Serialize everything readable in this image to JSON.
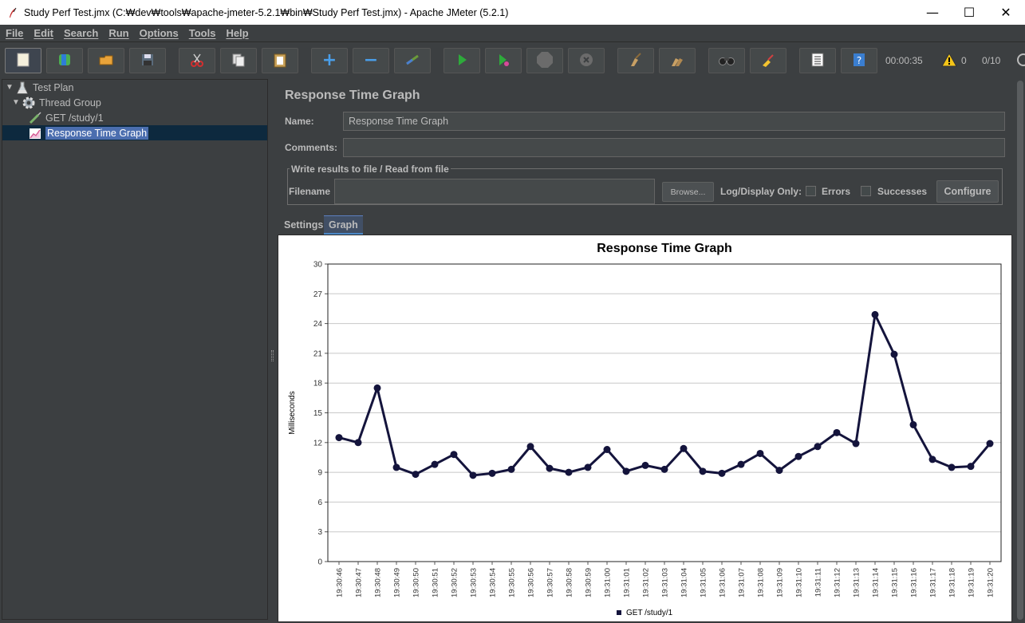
{
  "window": {
    "title": "Study Perf Test.jmx (C:₩dev₩tools₩apache-jmeter-5.2.1₩bin₩Study Perf Test.jmx) - Apache JMeter (5.2.1)",
    "minimize": "—",
    "maximize": "☐",
    "close": "✕"
  },
  "menu": {
    "items": [
      "File",
      "Edit",
      "Search",
      "Run",
      "Options",
      "Tools",
      "Help"
    ]
  },
  "toolbar": {
    "elapsed_time": "00:00:35",
    "warning_count": "0",
    "thread_count": "0/10",
    "icons": [
      "new-icon",
      "templates-icon",
      "open-icon",
      "save-icon",
      "cut-icon",
      "copy-icon",
      "paste-icon",
      "expand-icon",
      "collapse-icon",
      "toggle-icon",
      "start-icon",
      "start-no-pause-icon",
      "stop-icon",
      "shutdown-icon",
      "clear-icon",
      "clear-all-icon",
      "search-icon",
      "reset-search-icon",
      "function-helper-icon",
      "help-icon"
    ]
  },
  "tree": {
    "items": [
      {
        "label": "Test Plan",
        "icon": "test-plan-icon"
      },
      {
        "label": "Thread Group",
        "icon": "thread-group-icon"
      },
      {
        "label": "GET /study/1",
        "icon": "http-sampler-icon"
      },
      {
        "label": "Response Time Graph",
        "icon": "graph-listener-icon"
      }
    ]
  },
  "panel": {
    "title": "Response Time Graph",
    "name_label": "Name:",
    "name_value": "Response Time Graph",
    "comments_label": "Comments:",
    "comments_value": "",
    "group_title": "Write results to file / Read from file",
    "filename_label": "Filename",
    "filename_value": "",
    "browse_label": "Browse...",
    "log_display_label": "Log/Display Only:",
    "errors_label": "Errors",
    "successes_label": "Successes",
    "configure_label": "Configure",
    "tabs": [
      "Settings",
      "Graph"
    ],
    "active_tab": "Graph"
  },
  "chart_data": {
    "type": "line",
    "title": "Response Time Graph",
    "xlabel": "",
    "ylabel": "Milliseconds",
    "ylim": [
      0,
      30
    ],
    "yticks": [
      0,
      3,
      6,
      9,
      12,
      15,
      18,
      21,
      24,
      27,
      30
    ],
    "grid": true,
    "legend_position": "bottom",
    "x": [
      "19:30:46",
      "19:30:47",
      "19:30:48",
      "19:30:49",
      "19:30:50",
      "19:30:51",
      "19:30:52",
      "19:30:53",
      "19:30:54",
      "19:30:55",
      "19:30:56",
      "19:30:57",
      "19:30:58",
      "19:30:59",
      "19:31:00",
      "19:31:01",
      "19:31:02",
      "19:31:03",
      "19:31:04",
      "19:31:05",
      "19:31:06",
      "19:31:07",
      "19:31:08",
      "19:31:09",
      "19:31:10",
      "19:31:11",
      "19:31:12",
      "19:31:13",
      "19:31:14",
      "19:31:15",
      "19:31:16",
      "19:31:17",
      "19:31:18",
      "19:31:19",
      "19:31:20"
    ],
    "series": [
      {
        "name": "GET /study/1",
        "color": "#14143c",
        "values": [
          12.5,
          12,
          17.5,
          9.5,
          8.8,
          9.8,
          10.8,
          8.7,
          8.9,
          9.3,
          11.6,
          9.4,
          9,
          9.5,
          11.3,
          9.1,
          9.7,
          9.3,
          11.4,
          9.1,
          8.9,
          9.8,
          10.9,
          9.2,
          10.6,
          11.6,
          13,
          11.9,
          24.9,
          20.9,
          13.8,
          10.3,
          9.5,
          9.6,
          11.9
        ]
      }
    ]
  },
  "colors": {
    "background": "#3c3f41",
    "selection": "#4b6eaf",
    "series_line": "#14143c"
  }
}
